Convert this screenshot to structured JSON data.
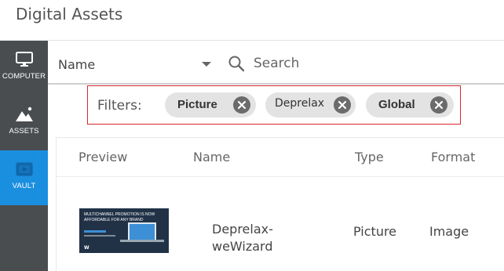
{
  "app": {
    "title": "Digital Assets"
  },
  "sidebar": {
    "items": [
      {
        "label": "COMPUTER",
        "icon": "monitor-icon",
        "active": false
      },
      {
        "label": "ASSETS",
        "icon": "mountains-icon",
        "active": false
      },
      {
        "label": "VAULT",
        "icon": "vault-play-icon",
        "active": true
      }
    ],
    "active_color": "#1a8fe0",
    "background": "#4a4d50"
  },
  "toolbar": {
    "sort_label": "Name",
    "search_placeholder": "Search"
  },
  "filters": {
    "label": "Filters:",
    "chips": [
      "Picture",
      "Deprelax",
      "Global"
    ],
    "highlight_color": "#d9262b"
  },
  "table": {
    "columns": [
      "Preview",
      "Name",
      "Type",
      "Format"
    ],
    "rows": [
      {
        "thumbnail_text": "MULTICHANNEL PROMOTION IS NOW AFFORDABLE FOR ANY BRAND",
        "name_line1": "Deprelax-",
        "name_line2": "weWizard",
        "type": "Picture",
        "format": "Image"
      }
    ]
  }
}
